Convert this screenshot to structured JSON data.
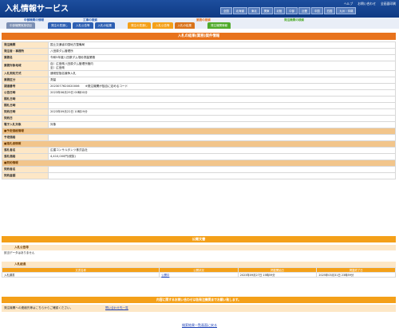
{
  "header": {
    "logo": "入札情報サービス",
    "top_links": [
      "ヘルプ",
      "お問い合わせ",
      "全画面印刷"
    ],
    "regions": [
      "全国",
      "北海道",
      "東北",
      "関東",
      "北陸",
      "中部",
      "近畿",
      "中国",
      "四国",
      "九州・沖縄"
    ]
  },
  "nav": {
    "group_labels": [
      "工事の検索",
      "業務の検索",
      "発注機関の検索"
    ],
    "tabs": [
      "中部機関実施項目",
      "発注の見通し",
      "入札公告等",
      "入札の結果",
      "発注の見通し",
      "入札公告等",
      "入札の結果",
      "発注機関情報"
    ],
    "left_label": "中部機関の情報"
  },
  "detail": {
    "title": "入札の結果(業務)案件情報",
    "rows": [
      {
        "k": "発注機関",
        "v": "国土交通省中国地方整備局"
      },
      {
        "k": "発注者・事務所",
        "v": "八田原ダム管理所"
      },
      {
        "k": "業務名",
        "v": "令和5年度八田原ダム堆砂測量業務"
      },
      {
        "k": "業務対象地域",
        "v": "自）広島県八田原ダム管理所管内\n至）広島県",
        "tall": true
      },
      {
        "k": "入札契約方式",
        "v": "通常型指名競争入札"
      },
      {
        "k": "業務区分",
        "v": "測量"
      },
      {
        "k": "調達番号",
        "v": "2023077620020006　　※発注機関が独自に定めるコード"
      },
      {
        "k": "公告日時",
        "v": "2023年06月29日 00時00分"
      },
      {
        "k": "開札日時",
        "v": ""
      },
      {
        "k": "開札日時",
        "v": ""
      },
      {
        "k": "契約日時",
        "v": "2023年09月22日 10時29分"
      },
      {
        "k": "契約日",
        "v": ""
      },
      {
        "k": "電子入札対象",
        "v": "対象"
      },
      {
        "k": "■予定価格情報",
        "v": "",
        "section": true
      },
      {
        "k": "予定価格",
        "v": ""
      },
      {
        "k": "■落札者情報",
        "v": "",
        "section": true
      },
      {
        "k": "落札者名",
        "v": "広建コンサルタンツ株式会社"
      },
      {
        "k": "落札価格",
        "v": "4,410,000円(税抜)"
      },
      {
        "k": "■契約情報",
        "v": "",
        "section": true
      },
      {
        "k": "契約者名",
        "v": ""
      },
      {
        "k": "契約金額",
        "v": ""
      }
    ]
  },
  "docs": {
    "title": "公開文書",
    "notice_label": "入札公告等",
    "notice_text": "該当データはありません",
    "results_label": "入札経過",
    "columns": [
      "文書名称",
      "公開状況",
      "掲載開始日",
      "掲載終了日"
    ],
    "rows": [
      [
        "入札調書",
        "公開中",
        "2023年09月27日 15時59分",
        "2025年03月31日 23時59分"
      ]
    ]
  },
  "contact": {
    "bar": "内容に関するお問い合わせは各発注機関までお願い致します。",
    "text": "発注機関への連絡先等はこちらからご確認ください。",
    "link": "問い合わせ先一覧"
  },
  "back_link": "検索結果一覧画面に戻る"
}
